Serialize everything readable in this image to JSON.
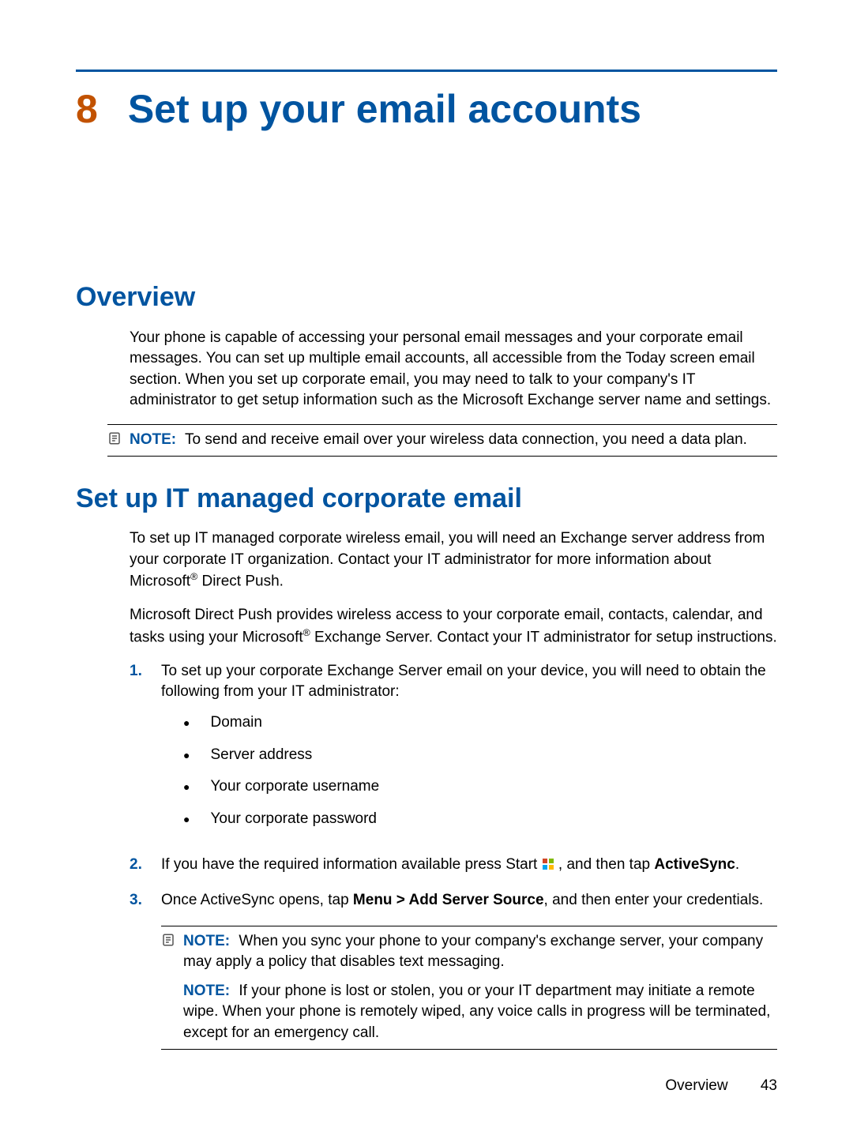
{
  "chapter": {
    "number": "8",
    "title": "Set up your email accounts"
  },
  "section_overview": {
    "heading": "Overview",
    "p1": "Your phone is capable of accessing your personal email messages and your corporate email messages. You can set up multiple email accounts, all accessible from the Today screen email section. When you set up corporate email, you may need to talk to your company's IT administrator to get setup information such as the Microsoft Exchange server name and settings.",
    "note_label": "NOTE:",
    "note_body": "To send and receive email over your wireless data connection, you need a data plan."
  },
  "section_it": {
    "heading": "Set up IT managed corporate email",
    "p1a": "To set up IT managed corporate wireless email, you will need an Exchange server address from your corporate IT organization. Contact your IT administrator for more information about Microsoft",
    "p1_reg": "®",
    "p1b": " Direct Push.",
    "p2a": "Microsoft Direct Push provides wireless access to your corporate email, contacts, calendar, and tasks using your Microsoft",
    "p2_reg": "®",
    "p2b": " Exchange Server. Contact your IT administrator for setup instructions.",
    "steps": {
      "s1": {
        "n": "1.",
        "text": "To set up your corporate Exchange Server email on your device, you will need to obtain the following from your IT administrator:",
        "bullets": [
          "Domain",
          "Server address",
          "Your corporate username",
          "Your corporate password"
        ]
      },
      "s2": {
        "n": "2.",
        "pre": "If you have the required information available press Start ",
        "mid": ", and then tap ",
        "bold": "ActiveSync",
        "post": "."
      },
      "s3": {
        "n": "3.",
        "pre": "Once ActiveSync opens, tap ",
        "bold": "Menu > Add Server Source",
        "post": ", and then enter your credentials."
      }
    },
    "note2": {
      "label": "NOTE:",
      "body": "When you sync your phone to your company's exchange server, your company may apply a policy that disables text messaging."
    },
    "note3": {
      "label": "NOTE:",
      "body": "If your phone is lost or stolen, you or your IT department may initiate a remote wipe. When your phone is remotely wiped, any voice calls in progress will be terminated, except for an emergency call."
    }
  },
  "footer": {
    "section": "Overview",
    "page": "43"
  }
}
